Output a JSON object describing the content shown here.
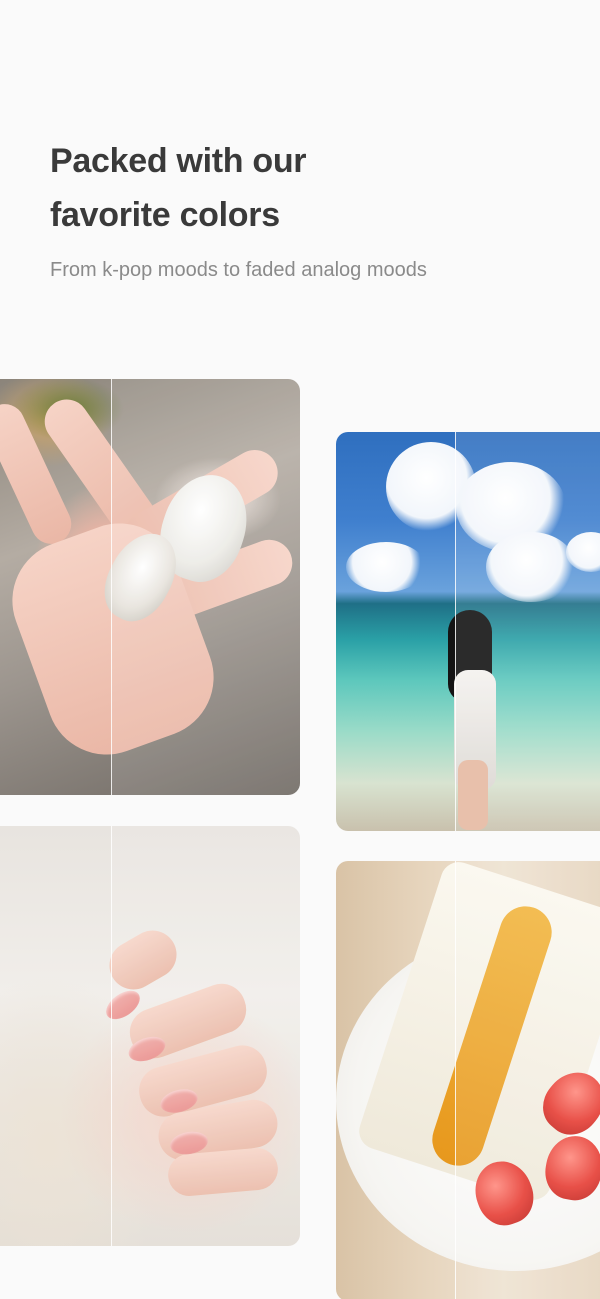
{
  "hero": {
    "title_line1": "Packed with our",
    "title_line2": "favorite colors",
    "subtitle": "From k-pop moods to faded analog moods"
  },
  "colors": {
    "background": "#fafafa",
    "title": "#3a3a3a",
    "subtitle": "#8a8a8a"
  },
  "gallery": {
    "photos": [
      {
        "subject": "hand-holding-seashells"
      },
      {
        "subject": "girl-on-beach"
      },
      {
        "subject": "pink-nails-on-sweater"
      },
      {
        "subject": "fruit-sandwich-with-strawberries"
      }
    ]
  }
}
